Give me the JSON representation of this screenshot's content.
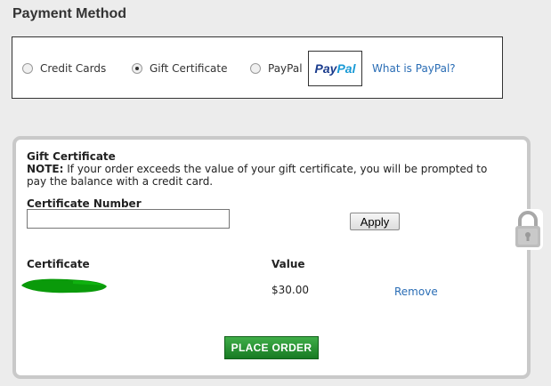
{
  "page": {
    "title": "Payment Method"
  },
  "payment_options": {
    "credit_cards": "Credit Cards",
    "gift_certificate": "Gift Certificate",
    "paypal": "PayPal",
    "paypal_logo_part1": "Pay",
    "paypal_logo_part2": "Pal",
    "what_is_paypal": "What is PayPal?",
    "selected": "gift_certificate"
  },
  "gift_panel": {
    "title": "Gift Certificate",
    "note_label": "NOTE:",
    "note_text": " If your order exceeds the value of your gift certificate, you will be prompted to pay the balance with a credit card.",
    "certificate_number_label": "Certificate Number",
    "certificate_number_value": "",
    "apply_label": "Apply",
    "table": {
      "col_certificate": "Certificate",
      "col_value": "Value",
      "rows": [
        {
          "certificate": "[redacted]",
          "value": "$30.00",
          "action": "Remove"
        }
      ]
    },
    "place_order_label": "PLACE ORDER"
  },
  "colors": {
    "link": "#2a6db5",
    "order_button": "#2a9a36",
    "panel_border": "#c9c9c9"
  },
  "icons": {
    "lock": "lock-icon"
  }
}
